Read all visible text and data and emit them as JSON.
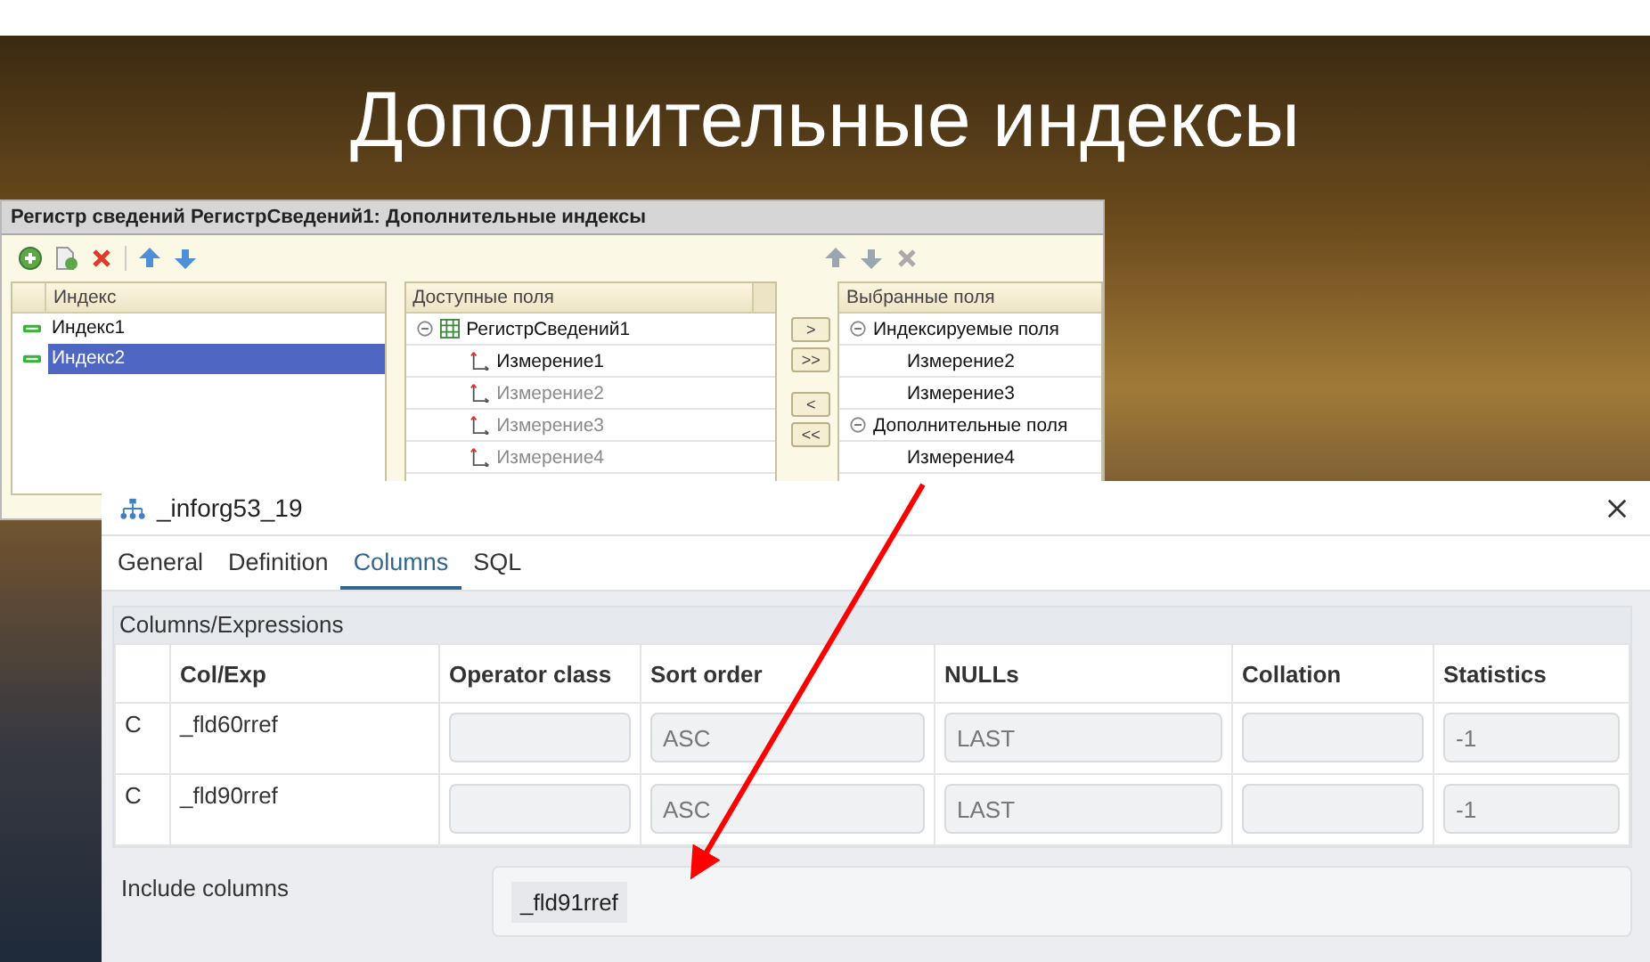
{
  "slide": {
    "title": "Дополнительные индексы"
  },
  "editor": {
    "title": "Регистр сведений РегистрСведений1: Дополнительные индексы",
    "index_list": {
      "header": "Индекс",
      "items": [
        {
          "label": "Индекс1",
          "selected": false
        },
        {
          "label": "Индекс2",
          "selected": true
        }
      ]
    },
    "available": {
      "header": "Доступные поля",
      "tree": [
        {
          "label": "РегистрСведений1",
          "expanded": true,
          "children": [
            {
              "label": "Измерение1",
              "disabled": false
            },
            {
              "label": "Измерение2",
              "disabled": true
            },
            {
              "label": "Измерение3",
              "disabled": true
            },
            {
              "label": "Измерение4",
              "disabled": true
            }
          ]
        }
      ]
    },
    "move_buttons": [
      ">",
      ">>",
      "<",
      "<<"
    ],
    "selected_fields": {
      "header": "Выбранные поля",
      "groups": [
        {
          "label": "Индексируемые поля",
          "expanded": true,
          "children": [
            {
              "label": "Измерение2"
            },
            {
              "label": "Измерение3"
            }
          ]
        },
        {
          "label": "Дополнительные поля",
          "expanded": true,
          "children": [
            {
              "label": "Измерение4"
            }
          ]
        }
      ]
    }
  },
  "dialog": {
    "title": "_inforg53_19",
    "tabs": [
      {
        "label": "General",
        "selected": false
      },
      {
        "label": "Definition",
        "selected": false
      },
      {
        "label": "Columns",
        "selected": true
      },
      {
        "label": "SQL",
        "selected": false
      }
    ],
    "section_title": "Columns/Expressions",
    "table": {
      "columns": [
        "Col/Exp",
        "Operator class",
        "Sort order",
        "NULLs",
        "Collation",
        "Statistics"
      ],
      "rows": [
        {
          "type": "C",
          "col_exp": "_fld60rref",
          "operator_class": "",
          "sort_order": "ASC",
          "nulls": "LAST",
          "collation": "",
          "statistics": "-1"
        },
        {
          "type": "C",
          "col_exp": "_fld90rref",
          "operator_class": "",
          "sort_order": "ASC",
          "nulls": "LAST",
          "collation": "",
          "statistics": "-1"
        }
      ]
    },
    "include_columns": {
      "label": "Include columns",
      "values": [
        "_fld91rref"
      ]
    }
  }
}
